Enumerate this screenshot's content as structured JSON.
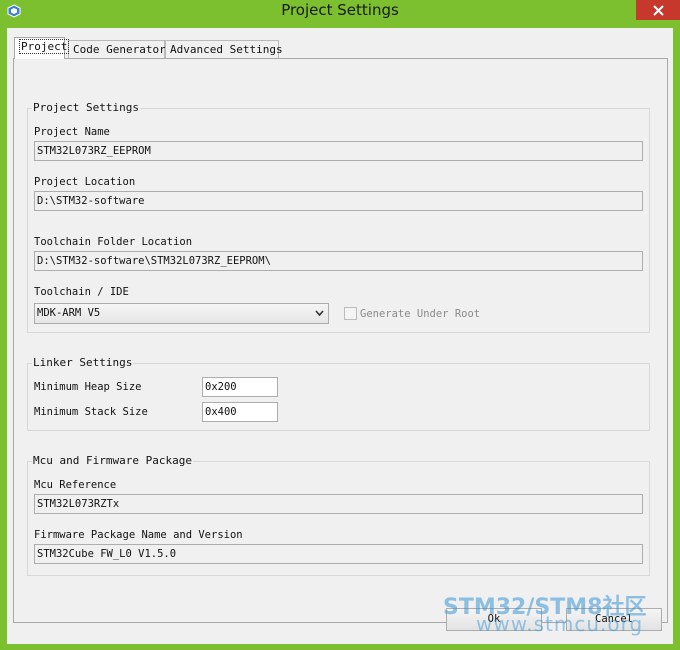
{
  "window": {
    "title": "Project Settings"
  },
  "tabs": [
    {
      "label": "Project",
      "active": true
    },
    {
      "label": "Code Generator",
      "active": false
    },
    {
      "label": "Advanced Settings",
      "active": false
    }
  ],
  "project_settings": {
    "group_title": "Project Settings",
    "project_name_label": "Project Name",
    "project_name_value": "STM32L073RZ_EEPROM",
    "project_location_label": "Project Location",
    "project_location_value": "D:\\STM32-software",
    "toolchain_folder_label": "Toolchain Folder Location",
    "toolchain_folder_value": "D:\\STM32-software\\STM32L073RZ_EEPROM\\",
    "toolchain_ide_label": "Toolchain / IDE",
    "toolchain_ide_value": "MDK-ARM V5",
    "generate_under_root_label": "Generate Under Root",
    "generate_under_root_checked": false
  },
  "linker_settings": {
    "group_title": "Linker Settings",
    "min_heap_label": "Minimum Heap Size",
    "min_heap_value": "0x200",
    "min_stack_label": "Minimum Stack Size",
    "min_stack_value": "0x400"
  },
  "mcu_package": {
    "group_title": "Mcu and Firmware Package",
    "mcu_reference_label": "Mcu Reference",
    "mcu_reference_value": "STM32L073RZTx",
    "firmware_label": "Firmware Package Name and Version",
    "firmware_value": "STM32Cube FW_L0 V1.5.0"
  },
  "buttons": {
    "ok_label": "Ok",
    "cancel_label": "Cancel"
  },
  "watermark": {
    "line1": "STM32/STM8社区",
    "line2": "www.stmcu.org"
  },
  "colors": {
    "titlebar": "#7cbf2f",
    "close_button": "#c7382c",
    "dialog_background": "#f0f0f0"
  }
}
